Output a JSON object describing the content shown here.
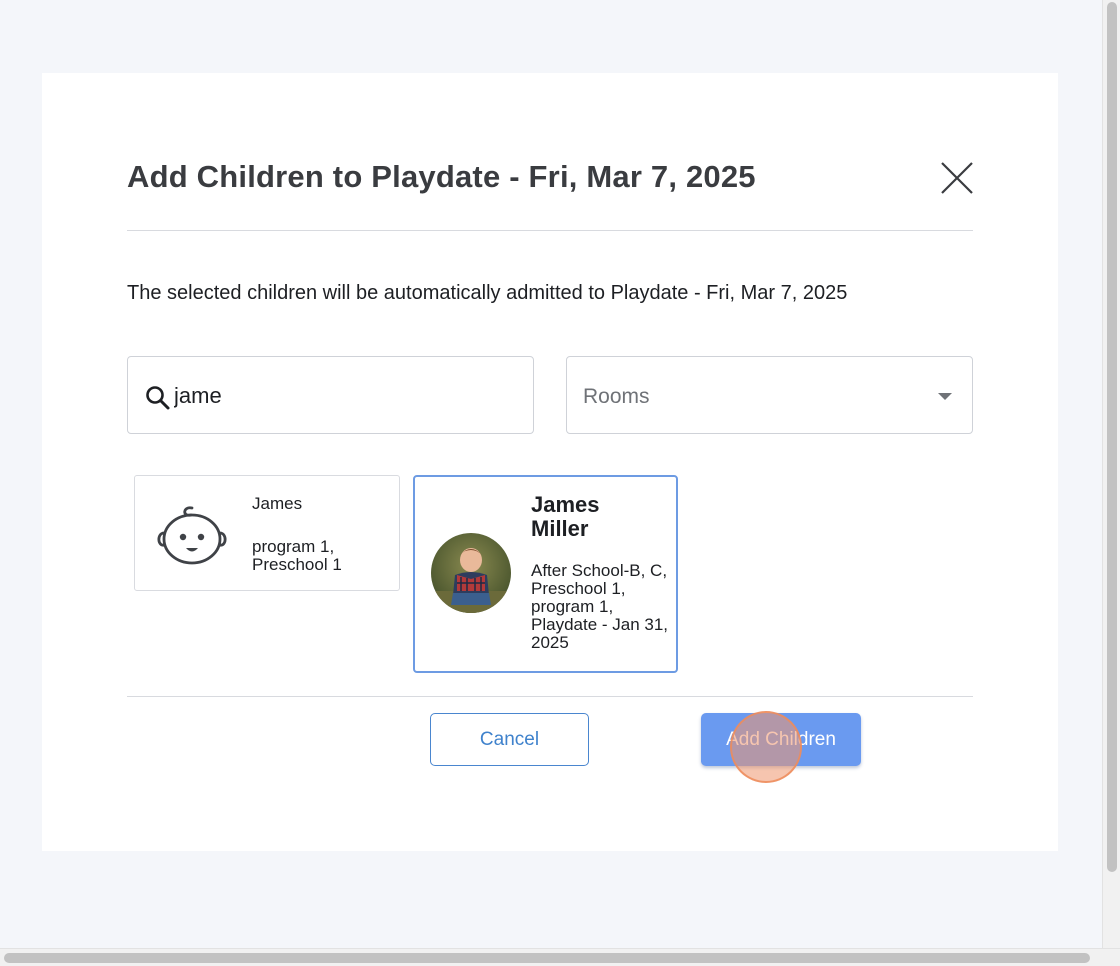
{
  "modal": {
    "title": "Add Children to Playdate - Fri, Mar 7, 2025",
    "subtitle": "The selected children will be automatically admitted to Playdate - Fri, Mar 7, 2025",
    "close_icon": "close-icon"
  },
  "filters": {
    "search": {
      "value": "jame",
      "icon": "search-icon"
    },
    "rooms": {
      "label": "Rooms",
      "icon": "chevron-down-icon"
    }
  },
  "children": [
    {
      "name": "James",
      "details": "program 1, Preschool 1",
      "avatar": "baby-face-icon",
      "selected": false
    },
    {
      "name": "James Miller",
      "details": "After School-B, C, Preschool 1, program 1, Playdate - Jan 31, 2025",
      "avatar": "child-photo",
      "selected": true
    }
  ],
  "actions": {
    "cancel_label": "Cancel",
    "add_label": "Add Children"
  },
  "colors": {
    "accent": "#6a9af0",
    "cancel_text": "#3f82cc",
    "selected_border": "#6d9be3",
    "title": "#3a3c40"
  }
}
